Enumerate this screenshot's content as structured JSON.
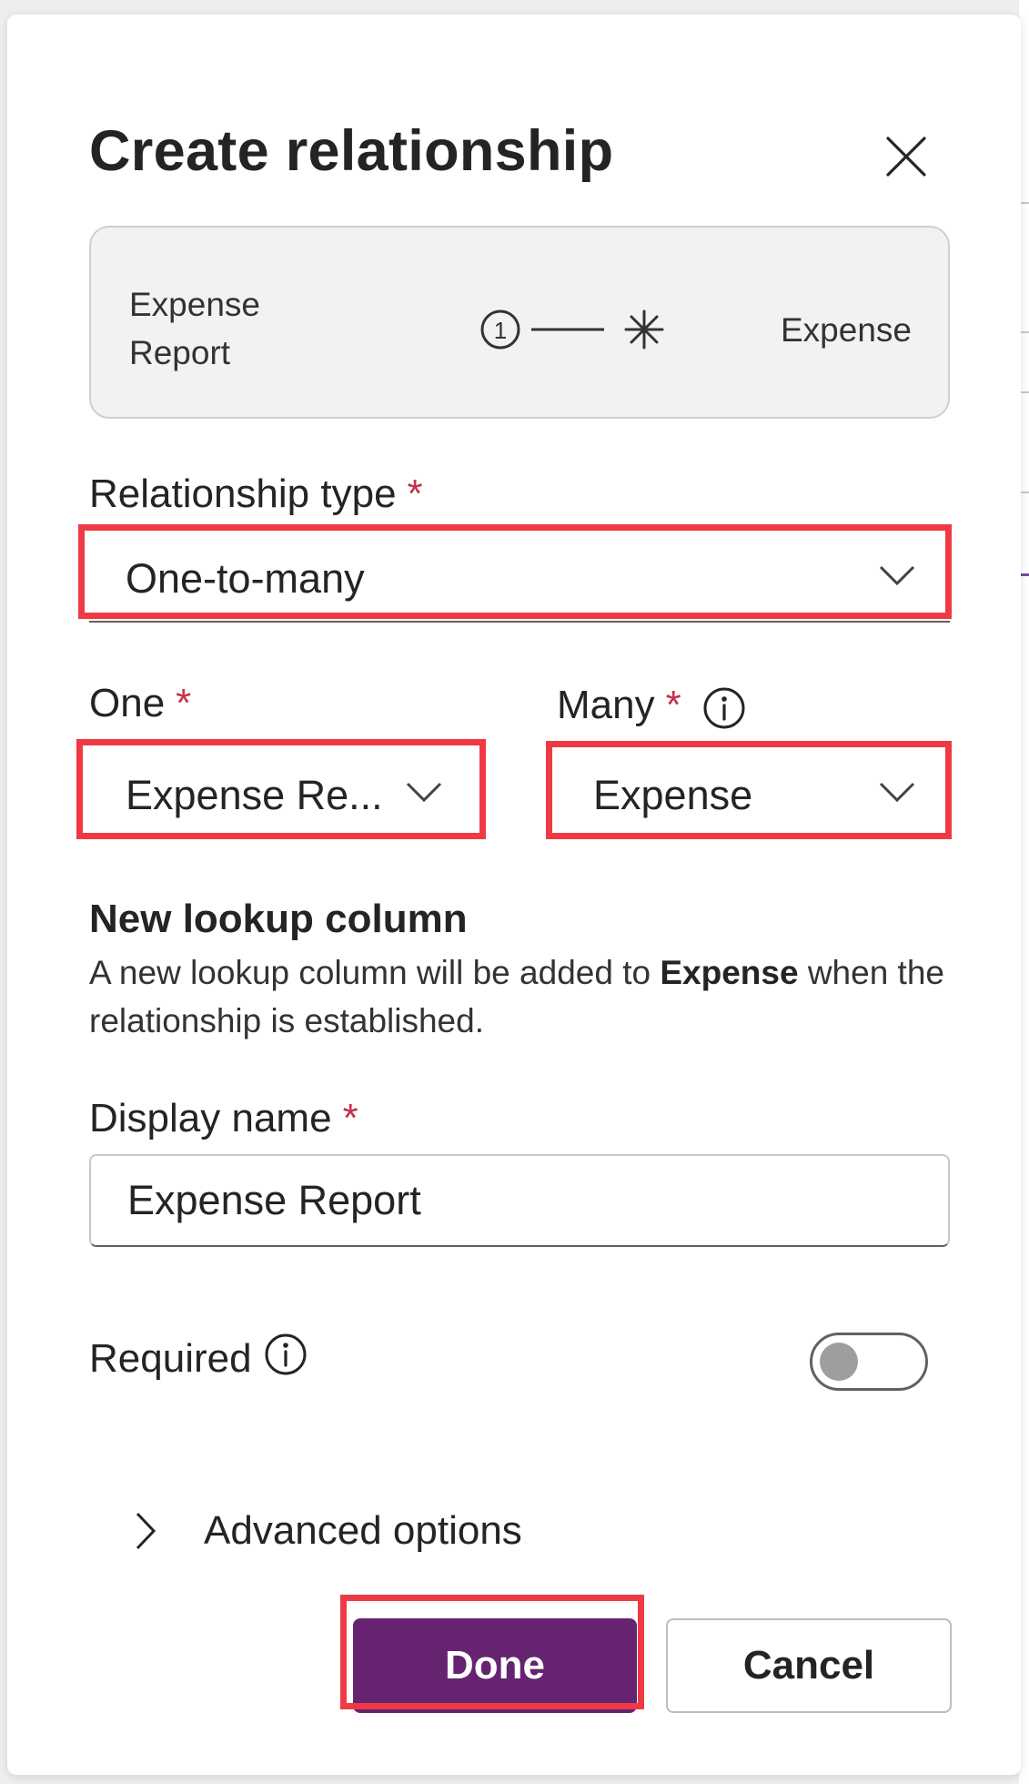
{
  "dialog": {
    "title": "Create relationship",
    "close_icon": "close-icon"
  },
  "summary": {
    "left_table": "Expense Report",
    "right_table": "Expense",
    "one_symbol": "1",
    "many_symbol": "✳"
  },
  "relationship_type": {
    "label": "Relationship type",
    "required_mark": "*",
    "value": "One-to-many"
  },
  "one": {
    "label": "One",
    "required_mark": "*",
    "value": "Expense Re..."
  },
  "many": {
    "label": "Many",
    "required_mark": "*",
    "value": "Expense"
  },
  "lookup": {
    "title": "New lookup column",
    "desc_prefix": "A new lookup column will be added to ",
    "desc_bold": "Expense",
    "desc_suffix": " when the relationship is established."
  },
  "display_name": {
    "label": "Display name",
    "required_mark": "*",
    "value": "Expense Report"
  },
  "required": {
    "label": "Required",
    "on": false
  },
  "advanced": {
    "label": "Advanced options"
  },
  "buttons": {
    "done": "Done",
    "cancel": "Cancel"
  },
  "colors": {
    "primary": "#652370",
    "required_star": "#c4314b",
    "highlight": "#ef3a45"
  }
}
